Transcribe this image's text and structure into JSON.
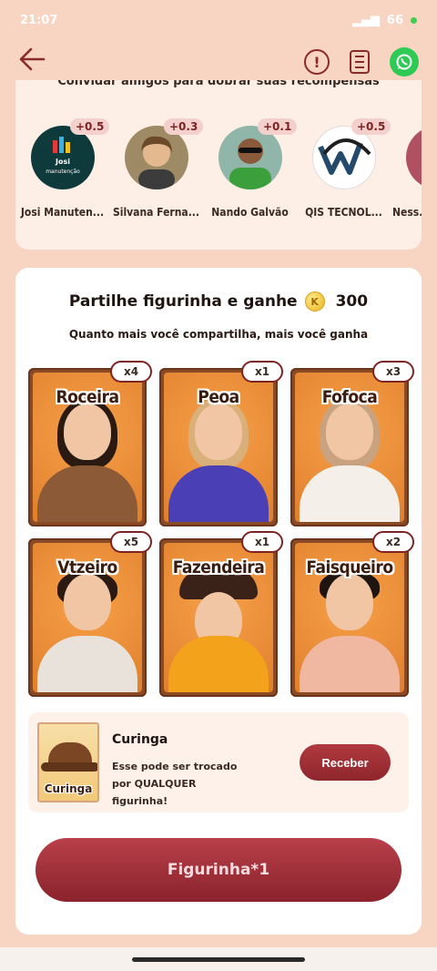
{
  "status_bar": {
    "time": "21:07",
    "battery": "66"
  },
  "header": {
    "back_icon": "arrow-left-icon",
    "alert_icon": "exclamation-icon",
    "doc_icon": "document-icon",
    "share_icon": "whatsapp-icon"
  },
  "friends": {
    "title": "Convidar amigos para dobrar suas recompensas",
    "items": [
      {
        "name": "Josi Manuten...",
        "bonus": "+0.5",
        "avatar_text": "Josi manutenção"
      },
      {
        "name": "Silvana Ferna...",
        "bonus": "+0.3"
      },
      {
        "name": "Nando Galvão",
        "bonus": "+0.1"
      },
      {
        "name": "QIS TECNOL...",
        "bonus": "+0.5"
      },
      {
        "name": "Ness...",
        "bonus": ""
      }
    ]
  },
  "share": {
    "title": "Partilhe figurinha e ganhe",
    "coin_value": "300",
    "subtitle": "Quanto mais você compartilha, mais você ganha"
  },
  "stickers": [
    {
      "label": "Roceira",
      "count": "x4",
      "hair": "#2b1a12",
      "body": "#8c5a37"
    },
    {
      "label": "Peoa",
      "count": "x1",
      "hair": "#d9b07a",
      "body": "#4a3fb5"
    },
    {
      "label": "Fofoca",
      "count": "x3",
      "hair": "#c9a37f",
      "body": "#f4efe9"
    },
    {
      "label": "Vtzeiro",
      "count": "x5",
      "hair": "#2b1a12",
      "body": "#e9e2da"
    },
    {
      "label": "Fazendeira",
      "count": "x1",
      "hair": "#3a2218",
      "body": "#f2a21b"
    },
    {
      "label": "Faisqueiro",
      "count": "x2",
      "hair": "#1e1410",
      "body": "#f0b8a0"
    }
  ],
  "curinga": {
    "card_label": "Curinga",
    "title": "Curinga",
    "description": "Esse pode ser trocado por QUALQUER figurinha!",
    "button": "Receber"
  },
  "main_button": "Figurinha*1"
}
